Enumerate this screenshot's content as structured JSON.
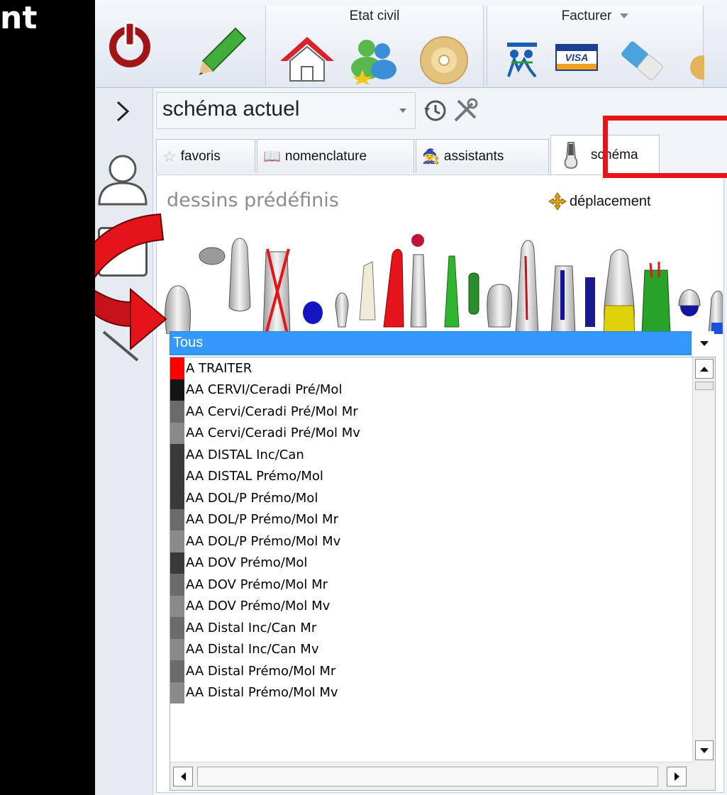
{
  "caption": "nt",
  "toolbar": {
    "etat_civil_label": "Etat civil",
    "facturer_label": "Facturer",
    "visa_text": "VISA"
  },
  "panel": {
    "schema_select_value": "schéma actuel",
    "tabs": [
      {
        "label": "favoris"
      },
      {
        "label": "nomenclature"
      },
      {
        "label": "assistants"
      },
      {
        "label": "schéma"
      }
    ],
    "section_title": "dessins prédéfinis",
    "deplacement_label": "déplacement",
    "filter_value": "Tous",
    "list_items": [
      {
        "label": "A TRAITER",
        "color": "#ff0000"
      },
      {
        "label": "AA CERVI/Ceradi Pré/Mol",
        "color": "#141414"
      },
      {
        "label": "AA Cervi/Ceradi Pré/Mol Mr",
        "color": "#6b6b6b"
      },
      {
        "label": "AA Cervi/Ceradi Pré/Mol Mv",
        "color": "#8a8a8a"
      },
      {
        "label": "AA DISTAL Inc/Can",
        "color": "#3a3a3a"
      },
      {
        "label": "AA DISTAL Prémo/Mol",
        "color": "#3a3a3a"
      },
      {
        "label": "AA DOL/P Prémo/Mol",
        "color": "#3a3a3a"
      },
      {
        "label": "AA DOL/P Prémo/Mol Mr",
        "color": "#6b6b6b"
      },
      {
        "label": "AA DOL/P Prémo/Mol Mv",
        "color": "#8a8a8a"
      },
      {
        "label": "AA DOV Prémo/Mol",
        "color": "#3a3a3a"
      },
      {
        "label": "AA DOV Prémo/Mol Mr",
        "color": "#6b6b6b"
      },
      {
        "label": "AA DOV Prémo/Mol Mv",
        "color": "#8a8a8a"
      },
      {
        "label": "AA Distal Inc/Can Mr",
        "color": "#6b6b6b"
      },
      {
        "label": "AA Distal Inc/Can Mv",
        "color": "#8a8a8a"
      },
      {
        "label": "AA Distal Prémo/Mol Mr",
        "color": "#6b6b6b"
      },
      {
        "label": "AA Distal Prémo/Mol Mv",
        "color": "#8a8a8a"
      }
    ]
  }
}
